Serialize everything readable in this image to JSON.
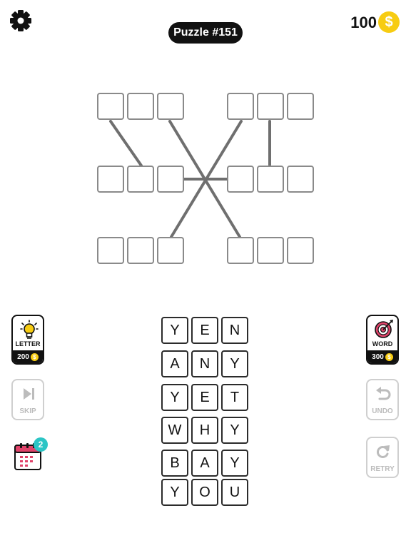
{
  "header": {
    "puzzle_label": "Puzzle #151",
    "coins": "100",
    "coin_symbol": "$"
  },
  "board": {
    "slot_groups": 6,
    "slots_per_group": 3
  },
  "word_bank": [
    [
      "Y",
      "E",
      "N"
    ],
    [
      "A",
      "N",
      "Y"
    ],
    [
      "Y",
      "E",
      "T"
    ],
    [
      "W",
      "H",
      "Y"
    ],
    [
      "B",
      "A",
      "Y"
    ],
    [
      "Y",
      "O",
      "U"
    ]
  ],
  "hints": {
    "letter": {
      "label": "LETTER",
      "cost": "200",
      "icon": "lightbulb-icon"
    },
    "word": {
      "label": "WORD",
      "cost": "300",
      "icon": "target-icon"
    }
  },
  "actions": {
    "skip": "SKIP",
    "undo": "UNDO",
    "retry": "RETRY",
    "daily_badge": "2"
  },
  "colors": {
    "coin": "#f7cc12",
    "badge": "#2cc5c5",
    "calendar": "#e0436a"
  }
}
